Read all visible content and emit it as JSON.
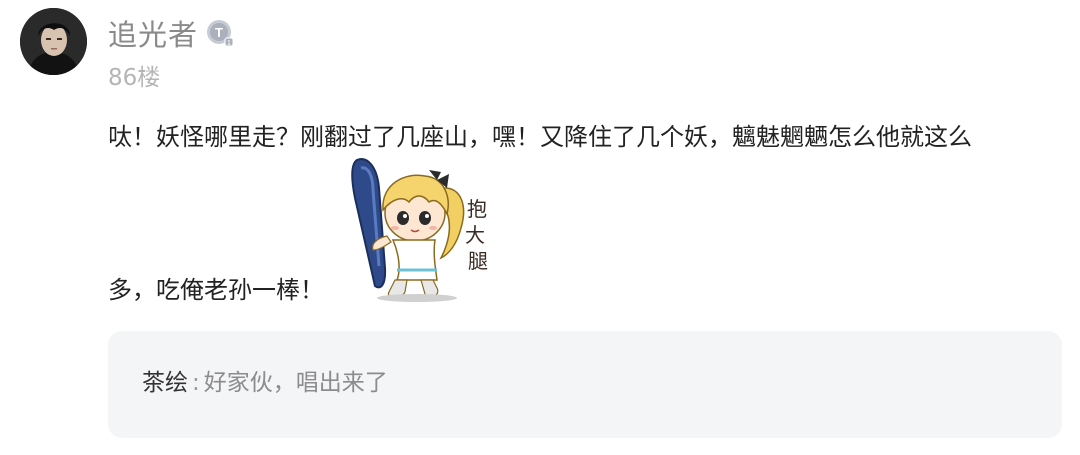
{
  "post": {
    "author": "追光者",
    "level_badge_icon": "level-t-icon",
    "floor": "86楼",
    "content_line1": "呔！妖怪哪里走？刚翻过了几座山，嘿！又降住了几个妖，魑魅魍魉怎么他就这么",
    "content_line2": "多，吃俺老孙一棒！",
    "sticker_text": "抱大腿",
    "sticker_icon": "hug-leg-sticker"
  },
  "reply": {
    "author": "茶绘",
    "separator": ":",
    "text": "好家伙，唱出来了"
  },
  "colors": {
    "author": "#8a8a8a",
    "floor": "#b5b5b5",
    "content": "#222222",
    "reply_bg": "#f4f5f7",
    "reply_text": "#8c8c8c"
  }
}
